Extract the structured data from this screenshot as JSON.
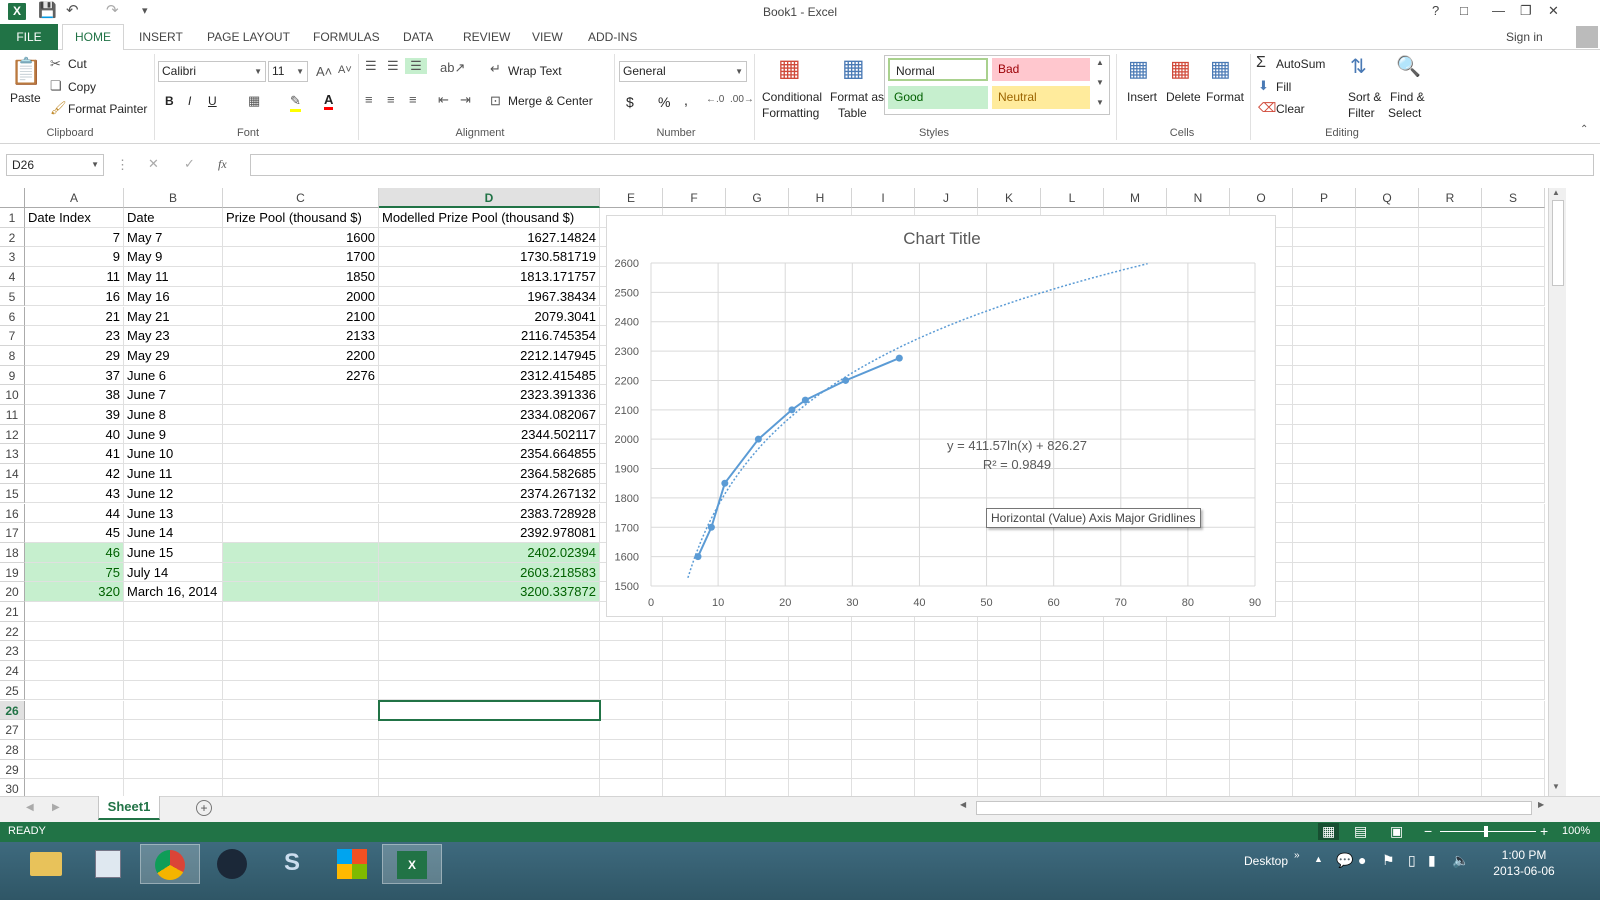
{
  "window": {
    "title": "Book1 - Excel",
    "help": "?",
    "sign_in": "Sign in"
  },
  "quick_access": {
    "save_icon": "save-icon",
    "undo_icon": "undo-icon",
    "redo_icon": "redo-icon"
  },
  "ribbon_tabs": {
    "file": "FILE",
    "home": "HOME",
    "insert": "INSERT",
    "page_layout": "PAGE LAYOUT",
    "formulas": "FORMULAS",
    "data": "DATA",
    "review": "REVIEW",
    "view": "VIEW",
    "add_ins": "ADD-INS"
  },
  "clipboard": {
    "paste": "Paste",
    "cut": "Cut",
    "copy": "Copy",
    "format_painter": "Format Painter",
    "label": "Clipboard"
  },
  "font": {
    "name": "Calibri",
    "size": "11",
    "bold": "B",
    "italic": "I",
    "underline": "U",
    "label": "Font"
  },
  "alignment": {
    "wrap_text": "Wrap Text",
    "merge_center": "Merge & Center",
    "label": "Alignment"
  },
  "number": {
    "format": "General",
    "currency": "$",
    "percent": "%",
    "comma": ",",
    "label": "Number"
  },
  "styles": {
    "conditional_1": "Conditional",
    "conditional_2": "Formatting",
    "format_table_1": "Format as",
    "format_table_2": "Table",
    "normal": "Normal",
    "bad": "Bad",
    "good": "Good",
    "neutral": "Neutral",
    "label": "Styles"
  },
  "cells": {
    "insert": "Insert",
    "delete": "Delete",
    "format": "Format",
    "label": "Cells"
  },
  "editing": {
    "autosum": "AutoSum",
    "fill": "Fill",
    "clear": "Clear",
    "sort_1": "Sort &",
    "sort_2": "Filter",
    "find_1": "Find &",
    "find_2": "Select",
    "label": "Editing"
  },
  "formula_bar": {
    "name_box": "D26",
    "fx": "fx",
    "formula": ""
  },
  "columns": [
    "A",
    "B",
    "C",
    "D",
    "E",
    "F",
    "G",
    "H",
    "I",
    "J",
    "K",
    "L",
    "M",
    "N",
    "O",
    "P",
    "Q",
    "R",
    "S"
  ],
  "rows": [
    {
      "n": "1",
      "a": "Date Index",
      "b": "Date",
      "c": "Prize Pool (thousand $)",
      "d": "Modelled Prize Pool (thousand $)"
    },
    {
      "n": "2",
      "a": "7",
      "b": "May 7",
      "c": "1600",
      "d": "1627.14824"
    },
    {
      "n": "3",
      "a": "9",
      "b": "May 9",
      "c": "1700",
      "d": "1730.581719"
    },
    {
      "n": "4",
      "a": "11",
      "b": "May 11",
      "c": "1850",
      "d": "1813.171757"
    },
    {
      "n": "5",
      "a": "16",
      "b": "May 16",
      "c": "2000",
      "d": "1967.38434"
    },
    {
      "n": "6",
      "a": "21",
      "b": "May 21",
      "c": "2100",
      "d": "2079.3041"
    },
    {
      "n": "7",
      "a": "23",
      "b": "May 23",
      "c": "2133",
      "d": "2116.745354"
    },
    {
      "n": "8",
      "a": "29",
      "b": "May 29",
      "c": "2200",
      "d": "2212.147945"
    },
    {
      "n": "9",
      "a": "37",
      "b": "June 6",
      "c": "2276",
      "d": "2312.415485"
    },
    {
      "n": "10",
      "a": "38",
      "b": "June 7",
      "c": "",
      "d": "2323.391336"
    },
    {
      "n": "11",
      "a": "39",
      "b": "June 8",
      "c": "",
      "d": "2334.082067"
    },
    {
      "n": "12",
      "a": "40",
      "b": "June 9",
      "c": "",
      "d": "2344.502117"
    },
    {
      "n": "13",
      "a": "41",
      "b": "June 10",
      "c": "",
      "d": "2354.664855"
    },
    {
      "n": "14",
      "a": "42",
      "b": "June 11",
      "c": "",
      "d": "2364.582685"
    },
    {
      "n": "15",
      "a": "43",
      "b": "June 12",
      "c": "",
      "d": "2374.267132"
    },
    {
      "n": "16",
      "a": "44",
      "b": "June 13",
      "c": "",
      "d": "2383.728928"
    },
    {
      "n": "17",
      "a": "45",
      "b": "June 14",
      "c": "",
      "d": "2392.978081"
    },
    {
      "n": "18",
      "a": "46",
      "b": "June 15",
      "c": "",
      "d": "2402.02394",
      "highlight": true
    },
    {
      "n": "19",
      "a": "75",
      "b": "July 14",
      "c": "",
      "d": "2603.218583",
      "highlight": true
    },
    {
      "n": "20",
      "a": "320",
      "b": "March 16, 2014",
      "c": "",
      "d": "3200.337872",
      "highlight": true
    },
    {
      "n": "21"
    },
    {
      "n": "22"
    },
    {
      "n": "23"
    },
    {
      "n": "24"
    },
    {
      "n": "25"
    },
    {
      "n": "26"
    },
    {
      "n": "27"
    },
    {
      "n": "28"
    },
    {
      "n": "29"
    },
    {
      "n": "30"
    }
  ],
  "chart_data": {
    "type": "scatter",
    "title": "Chart Title",
    "series": [
      {
        "values_x": [
          7,
          9,
          11,
          16,
          21,
          23,
          29,
          37
        ],
        "values_y": [
          1600,
          1700,
          1850,
          2000,
          2100,
          2133,
          2200,
          2276
        ]
      }
    ],
    "trendline": {
      "equation": "y = 411.57ln(x) + 826.27",
      "r2": "R² = 0.9849",
      "a": 411.57,
      "b": 826.27
    },
    "xlim": [
      0,
      90
    ],
    "ylim": [
      1500,
      2600
    ],
    "x_ticks": [
      "0",
      "10",
      "20",
      "30",
      "40",
      "50",
      "60",
      "70",
      "80",
      "90"
    ],
    "y_ticks": [
      "1500",
      "1600",
      "1700",
      "1800",
      "1900",
      "2000",
      "2100",
      "2200",
      "2300",
      "2400",
      "2500",
      "2600"
    ],
    "series_color": "#5b9bd5",
    "grid": true
  },
  "tooltip": "Horizontal (Value) Axis Major Gridlines",
  "sheet_tab": "Sheet1",
  "status": {
    "ready": "READY",
    "zoom": "100%"
  },
  "taskbar": {
    "desktop": "Desktop",
    "time": "1:00 PM",
    "date": "2013-06-06"
  }
}
